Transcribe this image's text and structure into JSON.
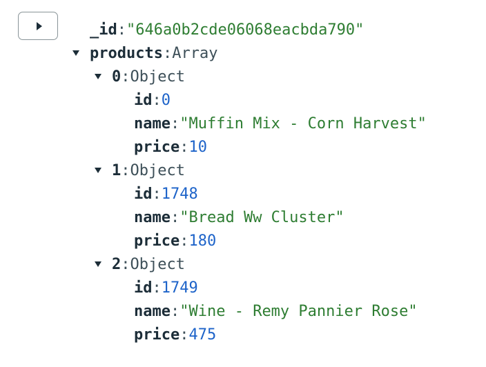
{
  "document": {
    "id": {
      "key": "_id",
      "value": "\"646a0b2cde06068eacbda790\""
    },
    "products": {
      "key": "products",
      "type": "Array",
      "items": [
        {
          "index": "0",
          "type": "Object",
          "id": {
            "key": "id",
            "value": "0"
          },
          "name": {
            "key": "name",
            "value": "\"Muffin Mix - Corn Harvest\""
          },
          "price": {
            "key": "price",
            "value": "10"
          }
        },
        {
          "index": "1",
          "type": "Object",
          "id": {
            "key": "id",
            "value": "1748"
          },
          "name": {
            "key": "name",
            "value": "\"Bread Ww Cluster\""
          },
          "price": {
            "key": "price",
            "value": "180"
          }
        },
        {
          "index": "2",
          "type": "Object",
          "id": {
            "key": "id",
            "value": "1749"
          },
          "name": {
            "key": "name",
            "value": "\"Wine - Remy Pannier Rose\""
          },
          "price": {
            "key": "price",
            "value": "475"
          }
        }
      ]
    }
  },
  "colors": {
    "key": "#1c2d38",
    "string": "#2e7d32",
    "number": "#1d63c9",
    "type": "#3d4f58"
  }
}
